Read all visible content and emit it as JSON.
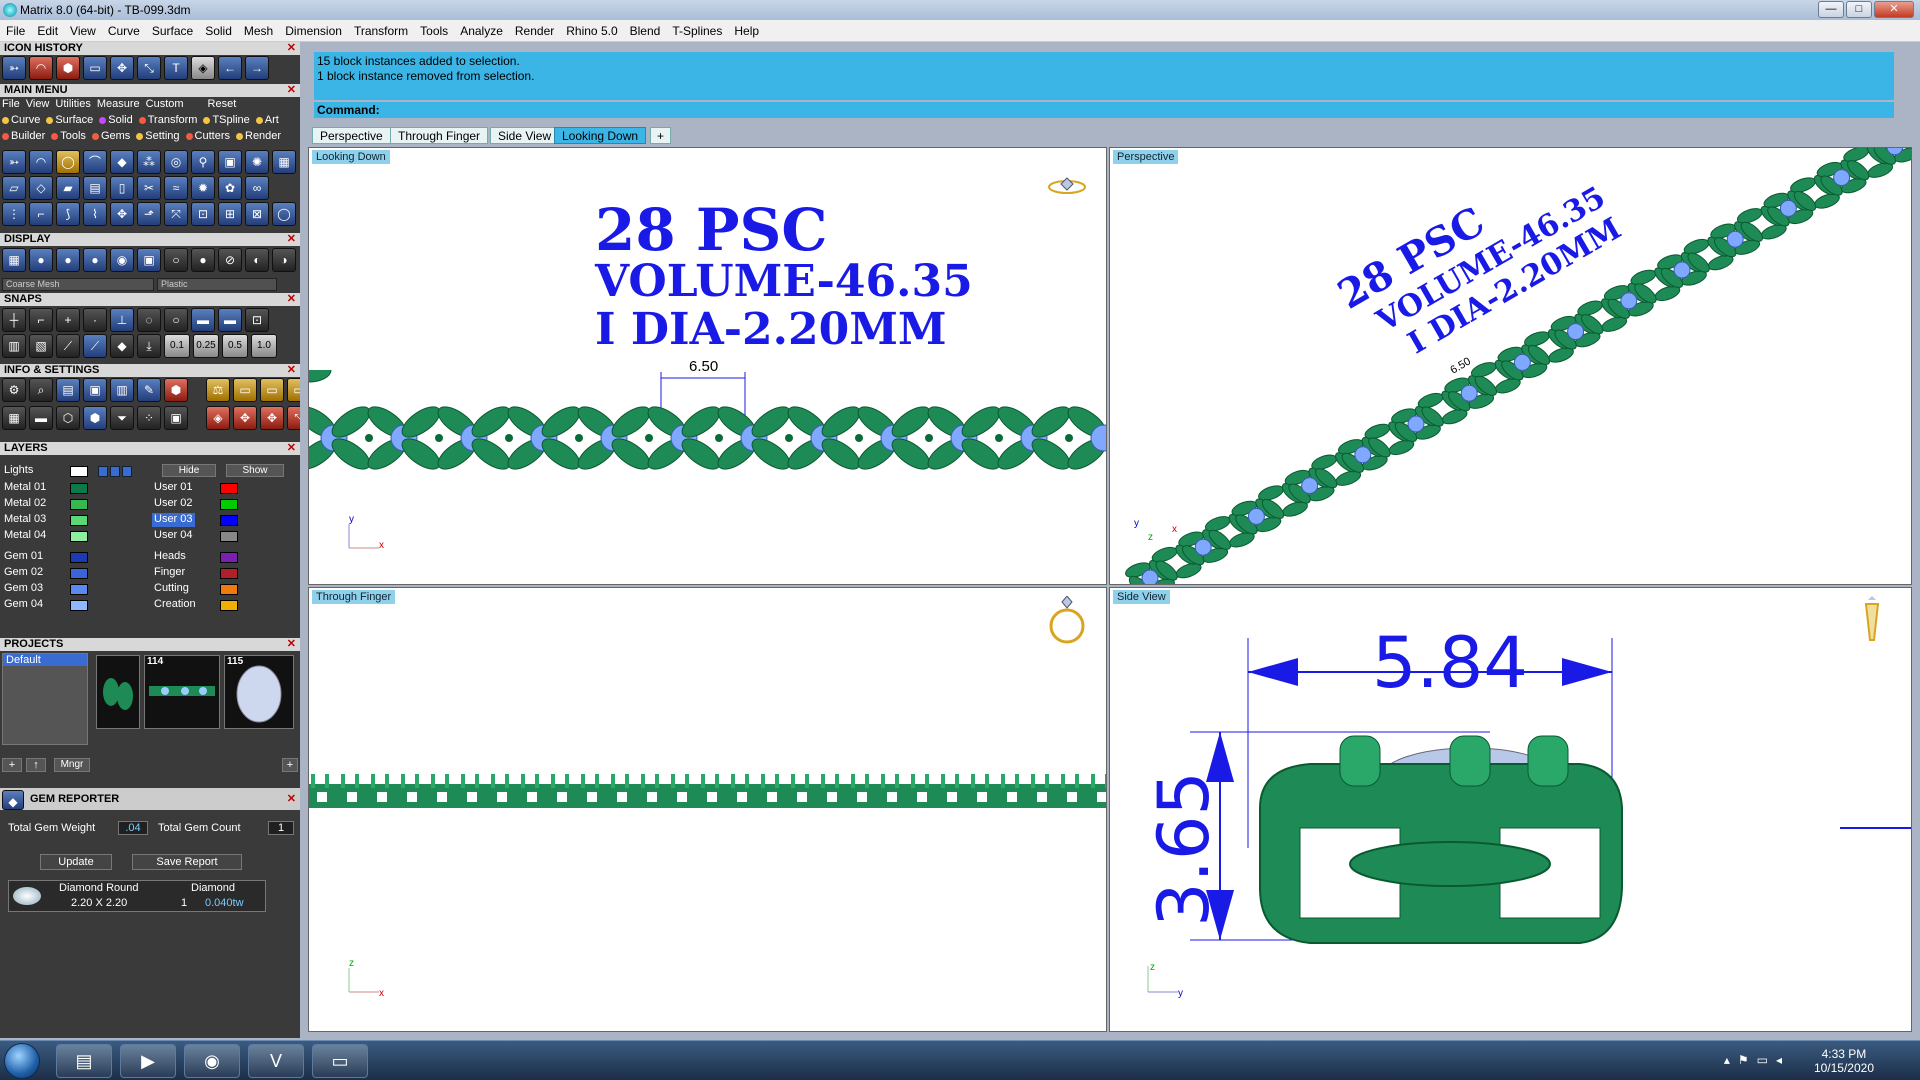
{
  "window": {
    "title": "Matrix 8.0 (64-bit) - TB-099.3dm",
    "min": "—",
    "max": "□",
    "close": "✕"
  },
  "menubar": [
    "File",
    "Edit",
    "View",
    "Curve",
    "Surface",
    "Solid",
    "Mesh",
    "Dimension",
    "Transform",
    "Tools",
    "Analyze",
    "Render",
    "Rhino 5.0",
    "Blend",
    "T-Splines",
    "Help"
  ],
  "left": {
    "icon_history": "ICON HISTORY",
    "main_menu": "MAIN MENU",
    "main_menu_items": [
      "File",
      "View",
      "Utilities",
      "Measure",
      "Custom",
      "Reset"
    ],
    "sub1": [
      "Curve",
      "Surface",
      "Solid",
      "Transform",
      "TSpline",
      "Art"
    ],
    "sub2": [
      "Builder",
      "Tools",
      "Gems",
      "Setting",
      "Cutters",
      "Render"
    ],
    "display": "DISPLAY",
    "coarse": "Coarse Mesh",
    "plastic": "Plastic",
    "snaps": "SNAPS",
    "snap_vals": [
      "0.1",
      "0.25",
      "0.5",
      "1.0"
    ],
    "info": "INFO & SETTINGS",
    "layers": "LAYERS",
    "lights": "Lights",
    "hide": "Hide",
    "show": "Show",
    "layers_left": [
      "Metal 01",
      "Metal 02",
      "Metal 03",
      "Metal 04",
      "Gem 01",
      "Gem 02",
      "Gem 03",
      "Gem 04"
    ],
    "layers_right": [
      "User 01",
      "User 02",
      "User 03",
      "User 04",
      "Heads",
      "Finger",
      "Cutting",
      "Creation"
    ],
    "projects": "PROJECTS",
    "proj_default": "Default",
    "proj_thumbs": [
      "114",
      "115"
    ],
    "mngr": "Mngr",
    "gem_reporter": "GEM REPORTER",
    "tgw_label": "Total Gem Weight",
    "tgw": ".04",
    "tgc_label": "Total Gem Count",
    "tgc": "1",
    "update": "Update",
    "save_report": "Save Report",
    "gem_shape": "Diamond Round",
    "gem_mat": "Diamond",
    "gem_size": "2.20 X 2.20",
    "gem_count": "1",
    "gem_weight": "0.040tw"
  },
  "command": {
    "hist1": "15 block instances added to selection.",
    "hist2": "1 block instance removed from selection.",
    "prompt": "Command:"
  },
  "tabs": [
    "Perspective",
    "Through Finger",
    "Side View",
    "Looking Down",
    "+"
  ],
  "viewports": {
    "top_left": {
      "label": "Looking Down",
      "l1": "28 PSC",
      "l2": "VOLUME-46.35",
      "l3": "I DIA-2.20MM",
      "dim": "6.50",
      "ax_y": "y",
      "ax_x": "x"
    },
    "top_right": {
      "label": "Perspective",
      "l1": "28 PSC",
      "l2": "VOLUME-46.35",
      "l3": "I DIA-2.20MM",
      "dim": "6.50",
      "ax_y": "y",
      "ax_x": "x",
      "ax_z": "z"
    },
    "bot_left": {
      "label": "Through Finger",
      "ax_y": "z",
      "ax_x": "x"
    },
    "bot_right": {
      "label": "Side View",
      "w": "5.84",
      "h": "3.65",
      "ax_y": "z",
      "ax_x": "y"
    }
  },
  "taskbar": {
    "time": "4:33 PM",
    "date": "10/15/2020"
  },
  "colors": {
    "accent": "#3bb5e6",
    "metal": "#1e8a55",
    "gem": "#7fa8ff",
    "dim": "#1a1ae6"
  }
}
